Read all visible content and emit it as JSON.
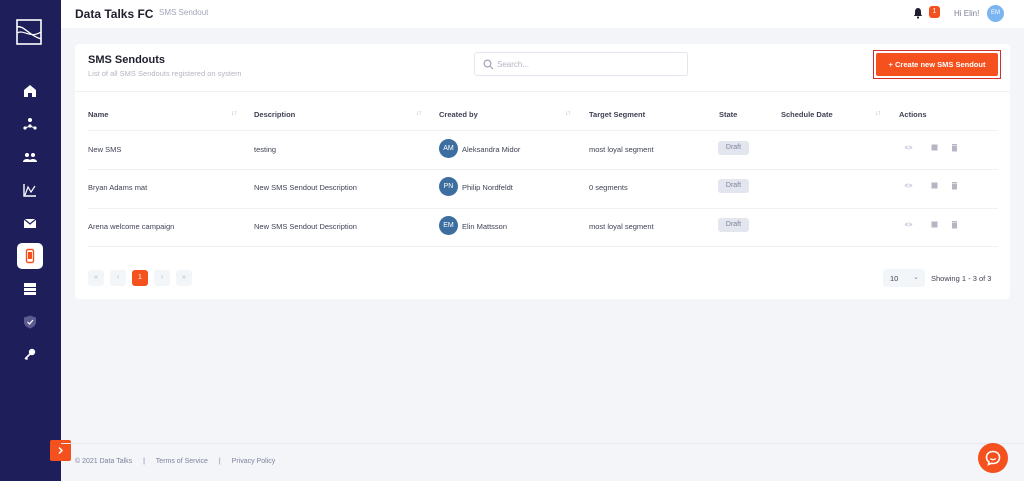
{
  "app": {
    "brand": "Data Talks FC",
    "breadcrumb": "SMS Sendout"
  },
  "header": {
    "notification_count": "1",
    "greeting": "Hi Elin!",
    "user_initials": "EM"
  },
  "page": {
    "title": "SMS Sendouts",
    "subtitle": "List of all SMS Sendouts registered on system",
    "search_placeholder": "Search...",
    "create_button": "+ Create new SMS Sendout"
  },
  "table": {
    "headers": [
      "Name",
      "Description",
      "Created by",
      "Target Segment",
      "State",
      "Schedule Date",
      "Actions"
    ],
    "rows": [
      {
        "name": "New SMS",
        "description": "testing",
        "initials": "AM",
        "created_by": "Aleksandra Midor",
        "segment": "most loyal segment",
        "state": "Draft",
        "schedule": ""
      },
      {
        "name": "Bryan Adams mat",
        "description": "New SMS Sendout Description",
        "initials": "PN",
        "created_by": "Philip Nordfeldt",
        "segment": "0 segments",
        "state": "Draft",
        "schedule": ""
      },
      {
        "name": "Arena welcome campaign",
        "description": "New SMS Sendout Description",
        "initials": "EM",
        "created_by": "Elin Mattsson",
        "segment": "most loyal segment",
        "state": "Draft",
        "schedule": ""
      }
    ]
  },
  "pagination": {
    "first": "«",
    "prev": "‹",
    "current": "1",
    "next": "›",
    "last": "»",
    "per_page": "10",
    "per_page_chevron": "⌄",
    "showing": "Showing 1 - 3 of 3"
  },
  "footer": {
    "copyright": "© 2021 Data Talks",
    "sep1": "|",
    "terms": "Terms of Service",
    "sep2": "|",
    "privacy": "Privacy Policy"
  },
  "sidebar": {
    "items": [
      "home-icon",
      "network-icon",
      "users-icon",
      "chart-icon",
      "mail-icon",
      "sms-icon",
      "server-icon",
      "shield-icon",
      "key-icon"
    ],
    "active": "sms-icon"
  },
  "colors": {
    "accent": "#f4511e",
    "sidebar": "#1e1e5a",
    "badge": "#e4e6ef"
  }
}
